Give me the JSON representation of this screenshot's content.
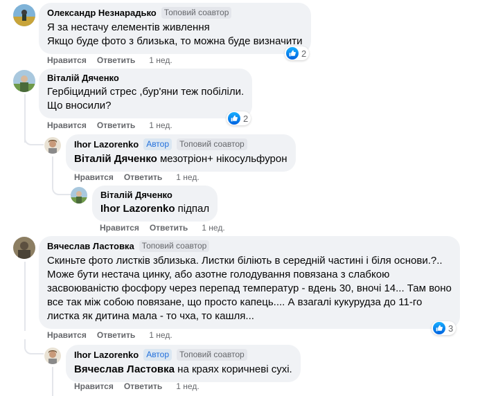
{
  "actions": {
    "like": "Нравится",
    "reply": "Ответить"
  },
  "colors": {
    "like_blue": "#1877f2",
    "bubble_bg": "#f0f2f5",
    "meta_gray": "#65676b"
  },
  "comments": [
    {
      "author": "Олександр Незнарадько",
      "badges": [
        "Топовий соавтор"
      ],
      "lines": [
        "Я за нестачу елементів живлення",
        "Якщо буде фото з близька, то можна буде визначити"
      ],
      "time": "1 нед.",
      "reactions": {
        "icon": "like-icon",
        "count": "2"
      }
    },
    {
      "author": "Віталій Дяченко",
      "badges": [],
      "lines": [
        "Гербіцидний стрес ,бур'яни теж побіліли.",
        "Що вносили?"
      ],
      "time": "1 нед.",
      "reactions": {
        "icon": "like-icon",
        "count": "2"
      },
      "replies": [
        {
          "author": "Ihor Lazorenko",
          "badges": [
            "Автор",
            "Топовий соавтор"
          ],
          "mention": "Віталій Дяченко",
          "text": " мезотріон+ нікосульфурон",
          "time": "1 нед."
        },
        {
          "author": "Віталій Дяченко",
          "badges": [],
          "mention": "Ihor Lazorenko",
          "text": " підпал",
          "time": "1 нед."
        }
      ]
    },
    {
      "author": "Вячеслав Ластовка",
      "badges": [
        "Топовий соавтор"
      ],
      "lines": [
        "Скиньте фото листків зблизька. Листки біліють в середній частині і біля основи.?..",
        "Може бути нестача цинку, або азотне голодування повязана з слабкою",
        "засвоюваністю фосфору через перепад температур - вдень 30, вночі 14... Там воно",
        "все так між собою повязане, що просто капець.... А взагалі кукурудза до 11-го",
        "листка як дитина мала - то чха, то кашля..."
      ],
      "time": "1 нед.",
      "reactions": {
        "icon": "like-icon",
        "count": "3"
      },
      "replies": [
        {
          "author": "Ihor Lazorenko",
          "badges": [
            "Автор",
            "Топовий соавтор"
          ],
          "mention": "Вячеслав Ластовка",
          "text": " на краях коричневі сухі.",
          "time": "1 нед."
        }
      ]
    }
  ]
}
